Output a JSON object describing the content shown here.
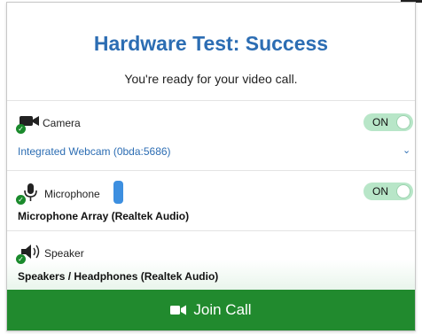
{
  "header": {
    "title": "Hardware Test: Success",
    "subtitle": "You're ready for your video call."
  },
  "camera": {
    "label": "Camera",
    "toggle": "ON",
    "device": "Integrated Webcam (0bda:5686)"
  },
  "microphone": {
    "label": "Microphone",
    "toggle": "ON",
    "device": "Microphone Array (Realtek Audio)"
  },
  "speaker": {
    "label": "Speaker",
    "device": "Speakers / Headphones (Realtek Audio)"
  },
  "join_button": {
    "label": "Join Call"
  },
  "colors": {
    "accent_blue": "#2c6db3",
    "success_green": "#218a2e",
    "toggle_on": "#b8e6c8",
    "mic_level_blue": "#3d8fe0"
  }
}
